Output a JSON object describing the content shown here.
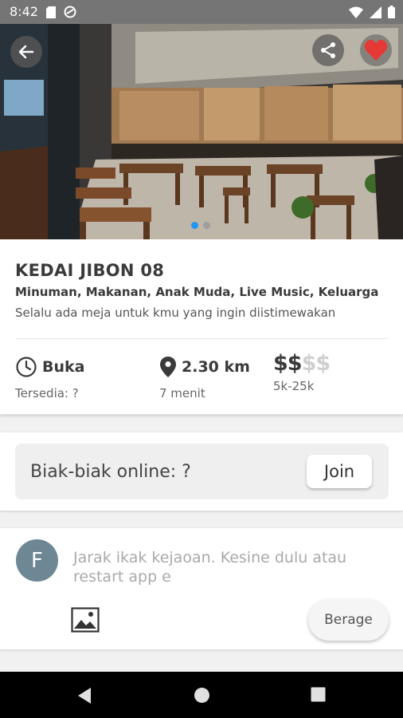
{
  "status_bar": {
    "time": "8:42",
    "icons_left": [
      "sd-card-icon",
      "do-not-disturb-icon"
    ],
    "icons_right": [
      "wifi-icon",
      "signal-icon",
      "battery-icon"
    ]
  },
  "hero": {
    "icons": {
      "back": "arrow-left-icon",
      "share": "share-icon",
      "favorite": "heart-icon"
    },
    "favorite_color": "#e53935",
    "carousel": {
      "count": 2,
      "active_index": 0,
      "active_color": "#2196f3"
    }
  },
  "venue": {
    "name": "KEDAI JIBON 08",
    "categories": "Minuman, Makanan, Anak Muda, Live Music, Keluarga",
    "tagline": "Selalu ada meja untuk kmu yang ingin diistimewakan",
    "status": {
      "icon": "clock-icon",
      "label": "Buka",
      "sub": "Tersedia: ?"
    },
    "distance": {
      "icon": "location-pin-icon",
      "label": "2.30 km",
      "sub": "7 menit"
    },
    "price": {
      "active": "$$",
      "inactive": "$$",
      "level": 2,
      "max_level": 4,
      "range": "5k-25k"
    }
  },
  "online": {
    "label": "Biak-biak online: ?",
    "join_label": "Join"
  },
  "post": {
    "avatar_letter": "F",
    "avatar_color": "#6e8794",
    "placeholder": "Jarak ikak kejaoan. Kesine dulu atau restart app e",
    "image_icon": "image-icon",
    "send_label": "Berage"
  },
  "nav_bar": {
    "icons": [
      "back-triangle-icon",
      "home-circle-icon",
      "recents-square-icon"
    ]
  }
}
